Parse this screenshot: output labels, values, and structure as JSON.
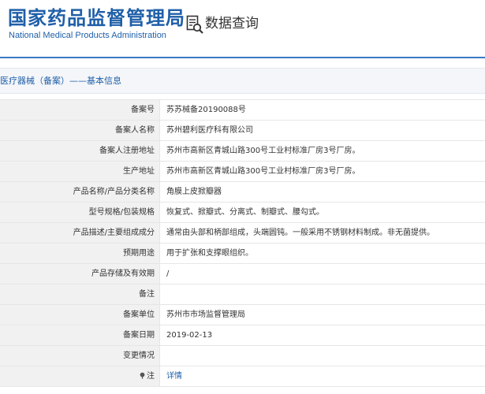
{
  "header": {
    "logo_cn": "国家药品监督管理局",
    "logo_en": "National Medical Products Administration",
    "query_title": "数据查询"
  },
  "breadcrumb": {
    "text": "医疗器械（备案）——基本信息"
  },
  "details": [
    {
      "label": "备案号",
      "value": "苏苏械备20190088号"
    },
    {
      "label": "备案人名称",
      "value": "苏州碧利医疗科有限公司"
    },
    {
      "label": "备案人注册地址",
      "value": "苏州市高新区青城山路300号工业村标准厂房3号厂房。"
    },
    {
      "label": "生产地址",
      "value": "苏州市高新区青城山路300号工业村标准厂房3号厂房。"
    },
    {
      "label": "产品名称/产品分类名称",
      "value": "角膜上皮掀瓣器"
    },
    {
      "label": "型号规格/包装规格",
      "value": "恢复式、掀瓣式、分离式、制瓣式、腰勾式。"
    },
    {
      "label": "产品描述/主要组成成分",
      "value": "通常由头部和柄部组成，头端圆钝。一般采用不锈钢材料制成。非无菌提供。"
    },
    {
      "label": "预期用途",
      "value": "用于扩张和支撑眼组织。"
    },
    {
      "label": "产品存储及有效期",
      "value": "/"
    },
    {
      "label": "备注",
      "value": ""
    },
    {
      "label": "备案单位",
      "value": "苏州市市场监督管理局"
    },
    {
      "label": "备案日期",
      "value": "2019-02-13"
    },
    {
      "label": "变更情况",
      "value": ""
    }
  ],
  "note_row": {
    "label": "注",
    "icon": "info-marker-icon",
    "link": "详情"
  },
  "colors": {
    "brand_blue": "#1f5fa8",
    "header_rule": "#3a78c3",
    "label_bg": "#f1f1f1"
  }
}
